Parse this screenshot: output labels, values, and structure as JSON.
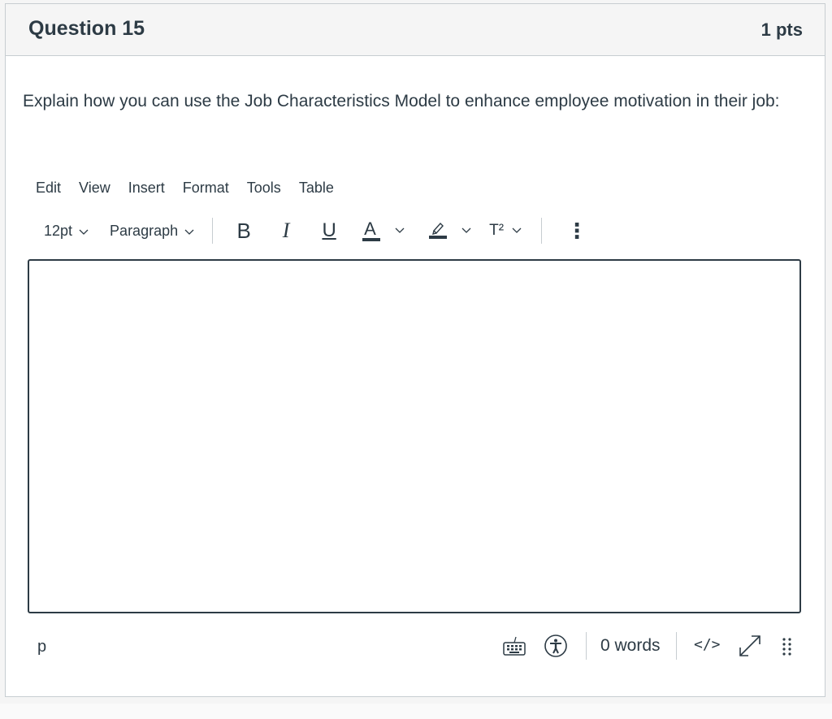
{
  "question": {
    "title": "Question 15",
    "points": "1 pts",
    "text": "Explain how you can use the Job Characteristics Model to enhance employee motivation in their job:"
  },
  "editor": {
    "menu": [
      "Edit",
      "View",
      "Insert",
      "Format",
      "Tools",
      "Table"
    ],
    "toolbar": {
      "font_size": "12pt",
      "block_format": "Paragraph",
      "bold_label": "B",
      "italic_label": "I",
      "underline_label": "U",
      "text_color_label": "A",
      "superscript_label": "T²",
      "more_label": "⋮",
      "icons": {
        "bold": "bold-icon",
        "italic": "italic-icon",
        "underline": "underline-icon",
        "text_color": "text-color-icon",
        "highlight": "highlight-icon",
        "superscript": "superscript-icon",
        "more": "more-vertical-icon"
      }
    },
    "content": "",
    "statusbar": {
      "path": "p",
      "word_count": "0 words",
      "html_toggle": "</>",
      "icons": [
        "keyboard-icon",
        "accessibility-icon",
        "fullscreen-icon",
        "resize-handle-icon"
      ]
    }
  },
  "colors": {
    "text": "#2d3b45",
    "border": "#c7cdd1",
    "header_bg": "#f5f5f5"
  }
}
